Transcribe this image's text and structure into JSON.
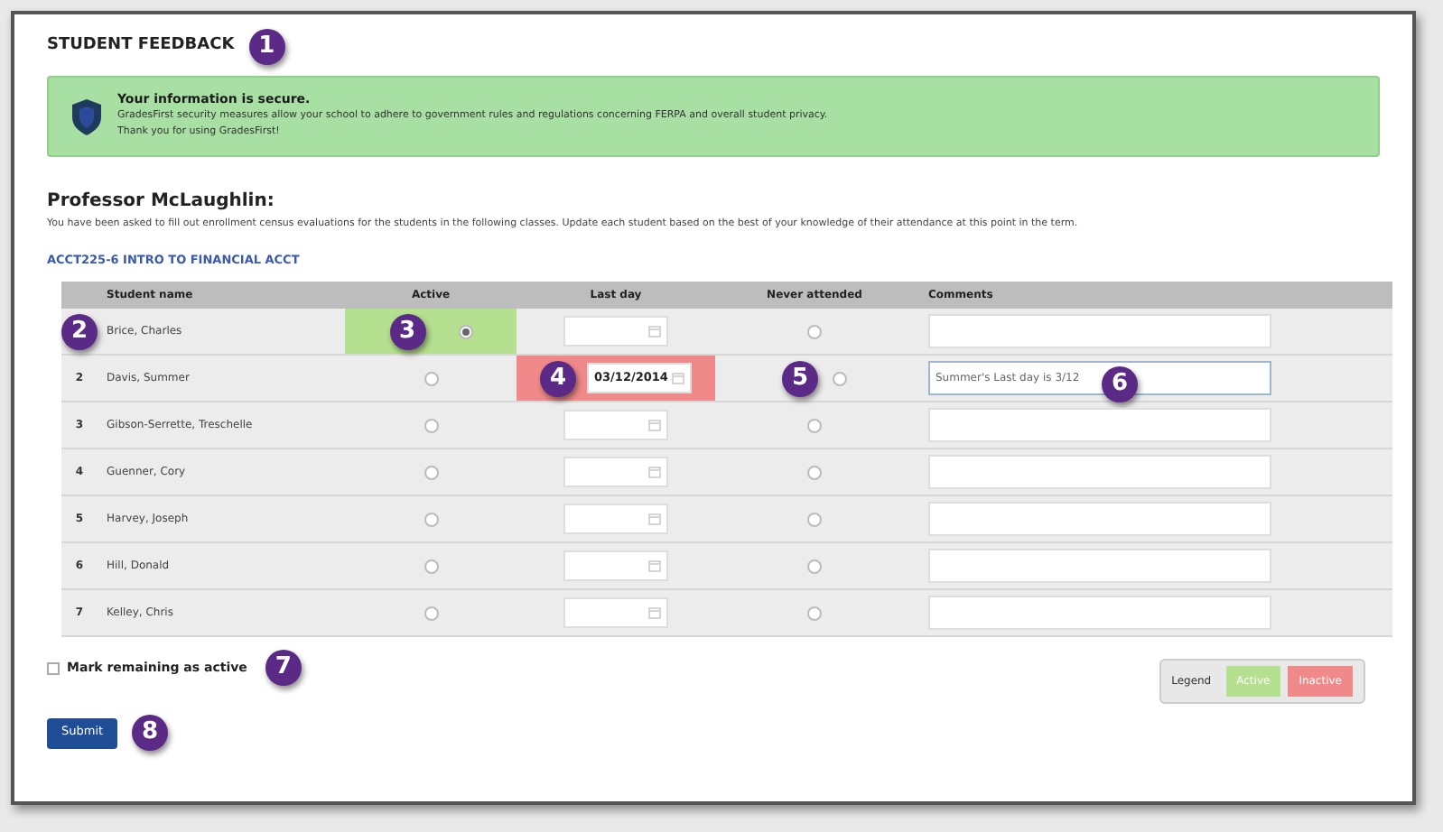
{
  "title": "STUDENT FEEDBACK",
  "notice": {
    "heading": "Your information is secure.",
    "lines": [
      "GradesFirst security measures allow your school to adhere to government rules and regulations concerning FERPA and overall student privacy.",
      "Thank you for using GradesFirst!"
    ]
  },
  "professor": "Professor McLaughlin:",
  "instructions": "You have been asked to fill out enrollment census evaluations for the students in the following classes. Update each student based on the best of your knowledge of their attendance at this point in the term.",
  "course": "ACCT225-6 INTRO TO FINANCIAL ACCT",
  "table": {
    "columns": [
      "Student name",
      "Active",
      "Last day",
      "Never attended",
      "Comments"
    ],
    "rows": [
      {
        "name": "Brice, Charles",
        "active": true,
        "never_attended": false,
        "marked_active": true,
        "marked_inactive": false,
        "last_day": "",
        "comment": ""
      },
      {
        "number": "2",
        "name": "Davis, Summer",
        "active": false,
        "never_attended": false,
        "marked_active": false,
        "marked_inactive": true,
        "last_day": "03/12/2014",
        "comment": "Summer's Last day is 3/12"
      },
      {
        "number": "3",
        "name": "Gibson-Serrette, Treschelle",
        "active": false,
        "never_attended": false,
        "marked_active": false,
        "marked_inactive": false,
        "last_day": "",
        "comment": ""
      },
      {
        "number": "4",
        "name": "Guenner, Cory",
        "active": false,
        "never_attended": false,
        "marked_active": false,
        "marked_inactive": false,
        "last_day": "",
        "comment": ""
      },
      {
        "number": "5",
        "name": "Harvey, Joseph",
        "active": false,
        "never_attended": false,
        "marked_active": false,
        "marked_inactive": false,
        "last_day": "",
        "comment": ""
      },
      {
        "number": "6",
        "name": "Hill, Donald",
        "active": false,
        "never_attended": false,
        "marked_active": false,
        "marked_inactive": false,
        "last_day": "",
        "comment": ""
      },
      {
        "number": "7",
        "name": "Kelley, Chris",
        "active": false,
        "never_attended": false,
        "marked_active": false,
        "marked_inactive": false,
        "last_day": "",
        "comment": ""
      }
    ]
  },
  "mark_remaining": {
    "label": "Mark remaining as active",
    "checked": false
  },
  "legend": {
    "label": "Legend",
    "items": [
      {
        "label": "Active",
        "color": "#b5e08f"
      },
      {
        "label": "Inactive",
        "color": "#f08a8a"
      }
    ]
  },
  "submit": "Submit",
  "callouts": [
    "1",
    "2",
    "3",
    "4",
    "5",
    "6",
    "7",
    "8"
  ]
}
